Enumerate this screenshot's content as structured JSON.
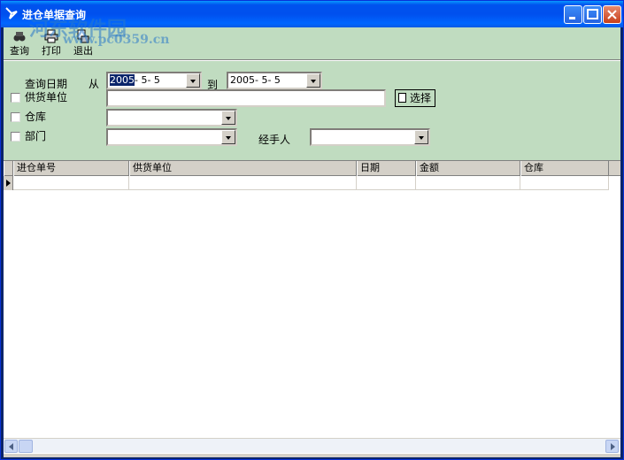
{
  "window": {
    "title": "进仓单据查询",
    "buttons": [
      "minimize",
      "maximize",
      "close"
    ]
  },
  "toolbar": {
    "items": [
      {
        "label": "查询",
        "icon": "binoculars-icon"
      },
      {
        "label": "打印",
        "icon": "printer-icon"
      },
      {
        "label": "退出",
        "icon": "exit-icon"
      }
    ]
  },
  "filters": {
    "date_label": "查询日期",
    "from_label": "从",
    "from_value_selected": "2005",
    "from_value_rest": "- 5- 5",
    "to_label": "到",
    "to_value": "2005- 5- 5",
    "supplier_label": "供货单位",
    "supplier_value": "",
    "choose_label": "选择",
    "warehouse_label": "仓库",
    "warehouse_value": "",
    "department_label": "部门",
    "department_value": "",
    "handler_label": "经手人",
    "handler_value": ""
  },
  "grid": {
    "columns": [
      "进仓单号",
      "供货单位",
      "日期",
      "金额",
      "仓库"
    ]
  },
  "watermark": {
    "brand": "河东软件园",
    "url": "www.pc0359.cn"
  },
  "colors": {
    "panel": "#c0dcc0",
    "titlebar": "#0054e3",
    "selection": "#0a246a"
  }
}
